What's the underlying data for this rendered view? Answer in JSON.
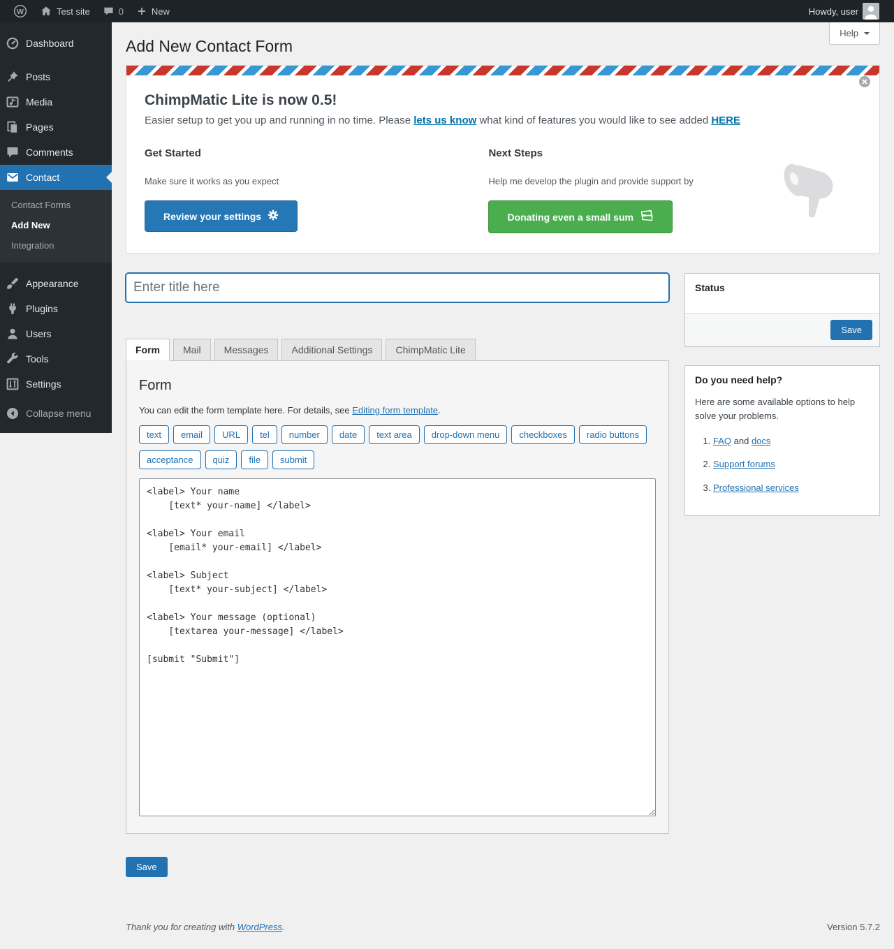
{
  "admin_bar": {
    "site_name": "Test site",
    "comments_count": "0",
    "new_label": "New",
    "howdy": "Howdy, user"
  },
  "help_tab": {
    "label": "Help"
  },
  "page": {
    "title": "Add New Contact Form"
  },
  "banner": {
    "heading": "ChimpMatic Lite is now 0.5!",
    "intro_pre": "Easier setup to get you up and running in no time. Please ",
    "intro_link1": "lets us know",
    "intro_mid": " what kind of features you would like to see added ",
    "intro_link2": "HERE",
    "get_started": {
      "heading": "Get Started",
      "text": "Make sure it works as you expect",
      "button": "Review your settings"
    },
    "next_steps": {
      "heading": "Next Steps",
      "text": "Help me develop the plugin and provide support by",
      "button": "Donating even a small sum"
    }
  },
  "editor": {
    "title_placeholder": "Enter title here",
    "active_tab": "Form",
    "tabs": [
      "Form",
      "Mail",
      "Messages",
      "Additional Settings",
      "ChimpMatic Lite"
    ],
    "panel": {
      "heading": "Form",
      "legend_pre": "You can edit the form template here. For details, see ",
      "legend_link": "Editing form template",
      "legend_post": ".",
      "tag_buttons": [
        "text",
        "email",
        "URL",
        "tel",
        "number",
        "date",
        "text area",
        "drop-down menu",
        "checkboxes",
        "radio buttons",
        "acceptance",
        "quiz",
        "file",
        "submit"
      ],
      "template": "<label> Your name\n    [text* your-name] </label>\n\n<label> Your email\n    [email* your-email] </label>\n\n<label> Subject\n    [text* your-subject] </label>\n\n<label> Your message (optional)\n    [textarea your-message] </label>\n\n[submit \"Submit\"]"
    },
    "save_button": "Save"
  },
  "status_box": {
    "title": "Status",
    "save_button": "Save"
  },
  "help_box": {
    "title": "Do you need help?",
    "intro": "Here are some available options to help solve your problems.",
    "item1_link1": "FAQ",
    "item1_mid": " and ",
    "item1_link2": "docs",
    "item2": "Support forums",
    "item3": "Professional services"
  },
  "footer": {
    "thanks_pre": "Thank you for creating with ",
    "thanks_link": "WordPress",
    "thanks_post": ".",
    "version": "Version 5.7.2"
  },
  "sidebar": {
    "items": [
      "Dashboard",
      "Posts",
      "Media",
      "Pages",
      "Comments",
      "Contact",
      "Appearance",
      "Plugins",
      "Users",
      "Tools",
      "Settings",
      "Collapse menu"
    ],
    "submenu": [
      "Contact Forms",
      "Add New",
      "Integration"
    ],
    "active_item": "Contact",
    "active_submenu": "Add New"
  },
  "colors": {
    "accent_blue": "#2271b1",
    "button_green": "#4aad4e",
    "banner_stripe_red": "#c9372c",
    "banner_stripe_blue": "#3697d3",
    "link_blue": "#0073aa",
    "admin_bar_bg": "#1d2327",
    "sidebar_bg": "#23282d"
  }
}
